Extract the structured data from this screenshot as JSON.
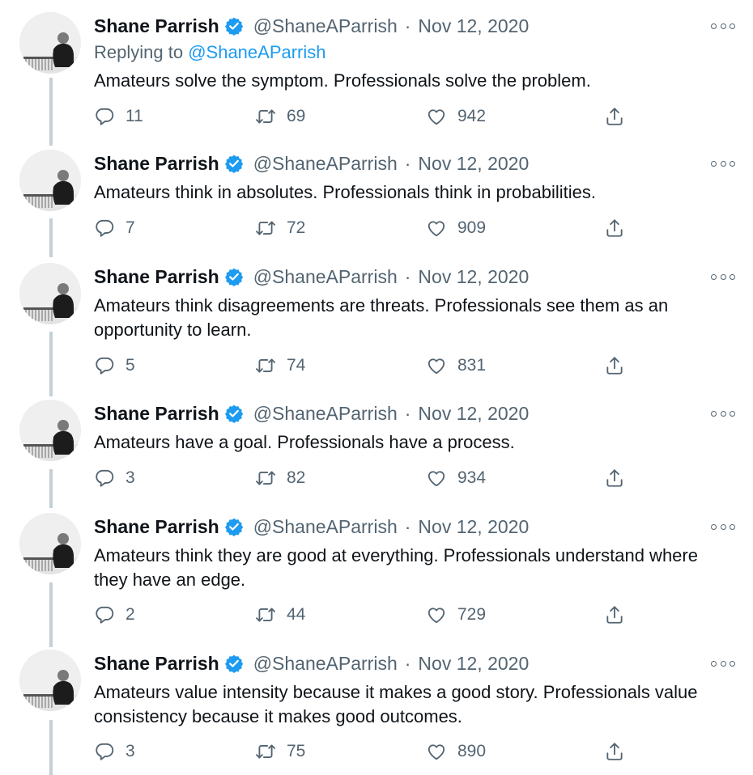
{
  "author": {
    "name": "Shane Parrish",
    "handle": "@ShaneAParrish",
    "separator": "·"
  },
  "colors": {
    "text": "#0f1419",
    "secondary": "#536471",
    "accent": "#1d9bf0",
    "thread_line": "#c4cfd6"
  },
  "icons": {
    "verified": "verified-badge-icon",
    "more": "more-options-icon",
    "reply": "reply-bubble-icon",
    "retweet": "retweet-arrows-icon",
    "like": "heart-icon",
    "share": "share-upload-icon"
  },
  "tweets": [
    {
      "date": "Nov 12, 2020",
      "reply_prefix": "Replying to",
      "reply_to": "@ShaneAParrish",
      "text": "Amateurs solve the symptom. Professionals solve the problem.",
      "replies": "11",
      "retweets": "69",
      "likes": "942"
    },
    {
      "date": "Nov 12, 2020",
      "text": "Amateurs think in absolutes. Professionals think in probabilities.",
      "replies": "7",
      "retweets": "72",
      "likes": "909"
    },
    {
      "date": "Nov 12, 2020",
      "text": "Amateurs think disagreements are threats. Professionals see them as an opportunity to learn.",
      "replies": "5",
      "retweets": "74",
      "likes": "831"
    },
    {
      "date": "Nov 12, 2020",
      "text": "Amateurs have a goal. Professionals have a process.",
      "replies": "3",
      "retweets": "82",
      "likes": "934"
    },
    {
      "date": "Nov 12, 2020",
      "text": "Amateurs think they are good at everything. Professionals understand where they have an edge.",
      "replies": "2",
      "retweets": "44",
      "likes": "729"
    },
    {
      "date": "Nov 12, 2020",
      "text": "Amateurs value intensity because it makes a good story. Professionals value consistency because it makes good outcomes.",
      "replies": "3",
      "retweets": "75",
      "likes": "890"
    }
  ]
}
